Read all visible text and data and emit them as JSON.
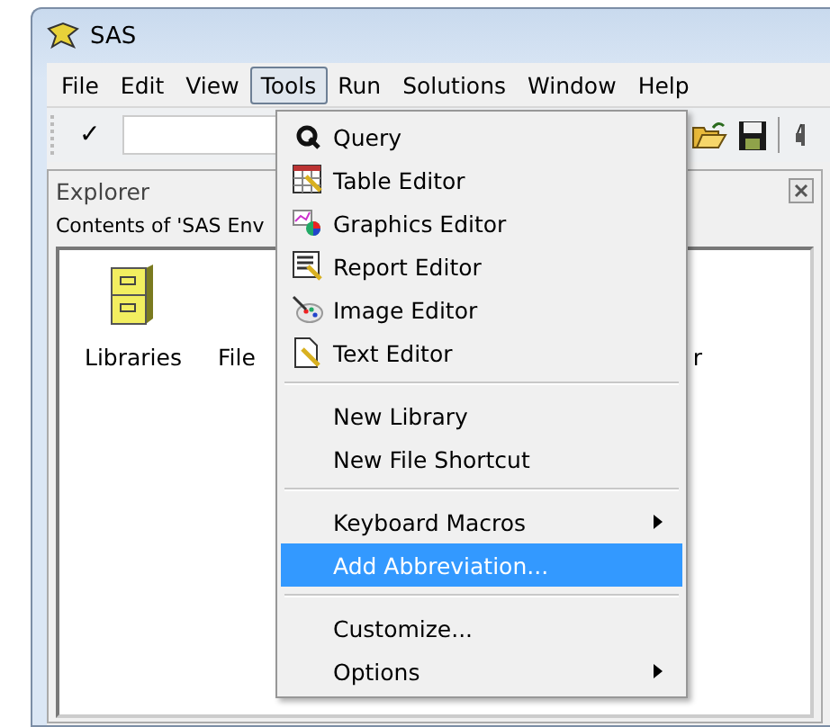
{
  "window": {
    "title": "SAS"
  },
  "menu_bar": [
    {
      "label": "File",
      "selected": false
    },
    {
      "label": "Edit",
      "selected": false
    },
    {
      "label": "View",
      "selected": false
    },
    {
      "label": "Tools",
      "selected": true
    },
    {
      "label": "Run",
      "selected": false
    },
    {
      "label": "Solutions",
      "selected": false
    },
    {
      "label": "Window",
      "selected": false
    },
    {
      "label": "Help",
      "selected": false
    }
  ],
  "toolbar": {
    "command_button": "✓"
  },
  "explorer": {
    "title": "Explorer",
    "path": "Contents of 'SAS Env",
    "items": [
      {
        "label": "Libraries"
      },
      {
        "label": "File"
      },
      {
        "label": "r"
      }
    ]
  },
  "tools_menu": [
    {
      "kind": "item",
      "label": "Query",
      "submenu": false,
      "selected": false
    },
    {
      "kind": "item",
      "label": "Table Editor",
      "submenu": false,
      "selected": false
    },
    {
      "kind": "item",
      "label": "Graphics Editor",
      "submenu": false,
      "selected": false
    },
    {
      "kind": "item",
      "label": "Report Editor",
      "submenu": false,
      "selected": false
    },
    {
      "kind": "item",
      "label": "Image Editor",
      "submenu": false,
      "selected": false
    },
    {
      "kind": "item",
      "label": "Text Editor",
      "submenu": false,
      "selected": false
    },
    {
      "kind": "separator"
    },
    {
      "kind": "item",
      "label": "New Library",
      "submenu": false,
      "selected": false
    },
    {
      "kind": "item",
      "label": "New File Shortcut",
      "submenu": false,
      "selected": false
    },
    {
      "kind": "separator"
    },
    {
      "kind": "item",
      "label": "Keyboard Macros",
      "submenu": true,
      "selected": false
    },
    {
      "kind": "item",
      "label": "Add Abbreviation...",
      "submenu": false,
      "selected": true
    },
    {
      "kind": "separator"
    },
    {
      "kind": "item",
      "label": "Customize...",
      "submenu": false,
      "selected": false
    },
    {
      "kind": "item",
      "label": "Options",
      "submenu": true,
      "selected": false
    }
  ]
}
